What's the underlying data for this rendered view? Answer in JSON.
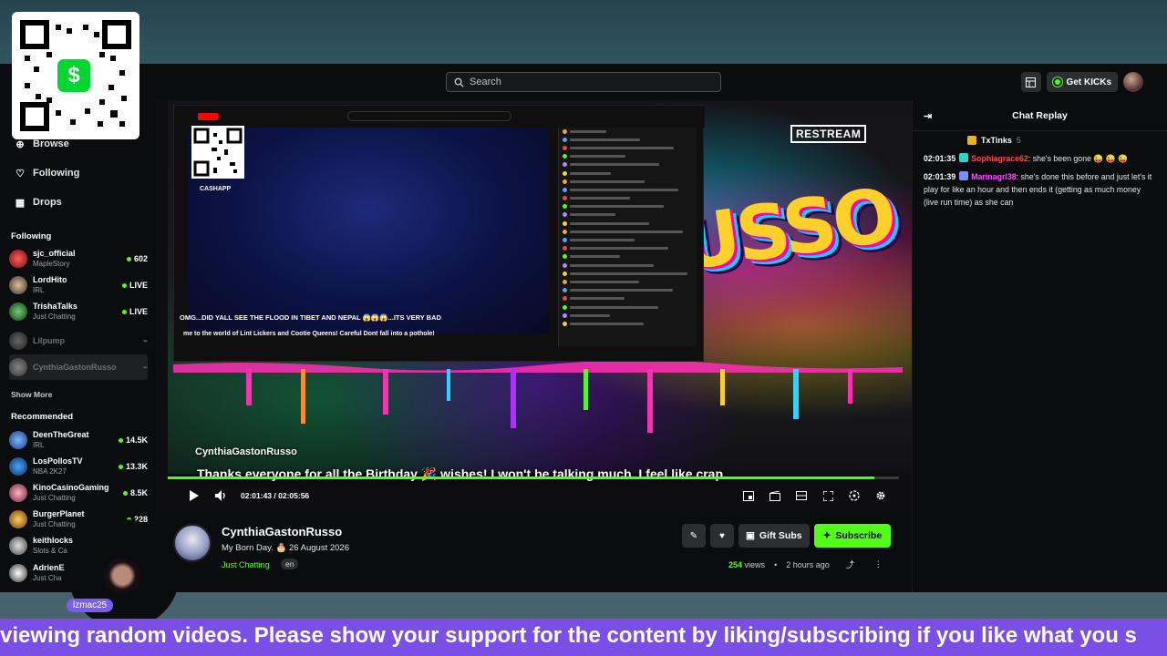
{
  "search": {
    "placeholder": "Search"
  },
  "topbar": {
    "get_kicks_label": "Get KICKs"
  },
  "sidebar": {
    "nav": [
      {
        "label": "Browse",
        "icon": "compass-icon"
      },
      {
        "label": "Following",
        "icon": "heart-icon"
      },
      {
        "label": "Drops",
        "icon": "gift-icon"
      }
    ],
    "following_title": "Following",
    "following": [
      {
        "name": "sjc_official",
        "category": "MapleStory",
        "count": "602",
        "live": true
      },
      {
        "name": "LordHito",
        "category": "IRL",
        "count": "LIVE",
        "live": true
      },
      {
        "name": "TrishaTalks",
        "category": "Just Chatting",
        "count": "LIVE",
        "live": true
      },
      {
        "name": "Lilpump",
        "category": "",
        "count": "",
        "live": false
      },
      {
        "name": "CynthiaGastonRusso",
        "category": "",
        "count": "",
        "live": false
      }
    ],
    "show_more": "Show More",
    "recommended_title": "Recommended",
    "recommended": [
      {
        "name": "DeenTheGreat",
        "category": "IRL",
        "count": "14.5K"
      },
      {
        "name": "LosPollosTV",
        "category": "NBA 2K27",
        "count": "13.3K"
      },
      {
        "name": "KinoCasinoGaming",
        "category": "Just Chatting",
        "count": "8.5K"
      },
      {
        "name": "BurgerPlanet",
        "category": "Just Chatting",
        "count": "228"
      },
      {
        "name": "keithlocks",
        "category": "Slots & Ca",
        "count": ""
      },
      {
        "name": "AdrienE",
        "category": "Just Cha",
        "count": ""
      }
    ]
  },
  "video": {
    "restream_label": "RESTREAM",
    "cashapp_label": "CASHAPP",
    "inner_headline": "OMG...DID YALL SEE THE FLOOD IN TIBET AND NEPAL 😱😱😱...ITS VERY BAD",
    "inner_banner": "me to the world of Lint Lickers and Cootie Queens!  Careful Dont fall into a pothole!",
    "graffiti_text": "USSO",
    "overlay_channel": "CynthiaGastonRusso",
    "caption": "Thanks everyone for all the Birthday 🎉 wishes! I won't be talking much. I feel like crap.",
    "current_time": "02:01:43",
    "duration": "02:05:56",
    "progress": 0.966
  },
  "info": {
    "channel_name": "CynthiaGastonRusso",
    "title": "My Born Day. 🎂 26 August 2026",
    "category": "Just Chatting",
    "language": "en",
    "gift_label": "Gift Subs",
    "subscribe_label": "Subscribe",
    "views": "254",
    "views_suffix": "views",
    "age": "2 hours ago"
  },
  "chat": {
    "title": "Chat Replay",
    "pinned_user": "TxTinks",
    "pinned_count": "5",
    "messages": [
      {
        "time": "02:01:35",
        "user": "Sophiagrace62",
        "text": ": she's been gone 😜 😜 😜"
      },
      {
        "time": "02:01:39",
        "user": "Marinagrl38",
        "text": ": she's done this before and just let's it play for like an hour and then ends it (getting as much money (live run time) as she can"
      }
    ]
  },
  "overlay": {
    "cam_name": "lzmac25",
    "ticker": "viewing random videos. Please show your support for the content by liking/subscribing if you like what you s"
  },
  "colors": {
    "accent": "#53fc18",
    "ticker_bg": "#7a4fe6"
  }
}
